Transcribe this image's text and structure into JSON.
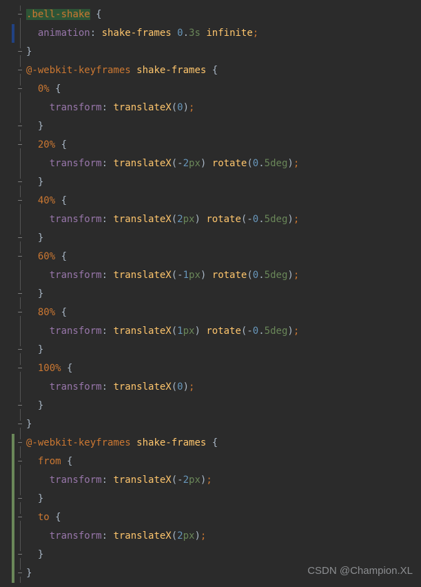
{
  "watermark": "CSDN @Champion.XL",
  "lines": [
    {
      "indent": 0,
      "foldOpen": true,
      "changeBar": "",
      "highlightRange": [
        1,
        12
      ],
      "tokens": [
        ".",
        "bell-shake",
        " ",
        "{"
      ],
      "classes": [
        "c-sel",
        "c-sel",
        "",
        "c-brace"
      ]
    },
    {
      "indent": 1,
      "foldOpen": false,
      "changeBar": "sel",
      "tokens": [
        "animation",
        ": ",
        "shake-frames",
        " ",
        "0",
        ".",
        "3",
        "s",
        " ",
        "infinite",
        ";"
      ],
      "classes": [
        "c-prop",
        "c-punc",
        "c-ident",
        "",
        "c-num",
        "c-punc",
        "c-numg",
        "c-unit",
        "",
        "c-ident",
        "c-semi"
      ]
    },
    {
      "indent": 0,
      "foldClose": true,
      "tokens": [
        "}"
      ],
      "classes": [
        "c-brace"
      ]
    },
    {
      "indent": 0,
      "foldOpen": true,
      "tokens": [
        "@-webkit-keyframes",
        " ",
        "shake-frames",
        " ",
        "{"
      ],
      "classes": [
        "c-sel",
        "",
        "c-ident",
        "",
        "c-brace"
      ]
    },
    {
      "indent": 1,
      "foldOpen": true,
      "tokens": [
        "0%",
        " ",
        "{"
      ],
      "classes": [
        "c-sel",
        "",
        "c-brace"
      ]
    },
    {
      "indent": 2,
      "tokens": [
        "transform",
        ": ",
        "translateX",
        "(",
        "0",
        ")",
        ";"
      ],
      "classes": [
        "c-prop",
        "c-punc",
        "c-func",
        "c-punc",
        "c-num",
        "c-punc",
        "c-semi"
      ]
    },
    {
      "indent": 1,
      "foldClose": true,
      "tokens": [
        "}"
      ],
      "classes": [
        "c-brace"
      ]
    },
    {
      "indent": 1,
      "foldOpen": true,
      "tokens": [
        "20%",
        " ",
        "{"
      ],
      "classes": [
        "c-sel",
        "",
        "c-brace"
      ]
    },
    {
      "indent": 2,
      "tokens": [
        "transform",
        ": ",
        "translateX",
        "(",
        "-",
        "2",
        "px",
        ") ",
        "rotate",
        "(",
        "0",
        ".",
        "5",
        "deg",
        ")",
        ";"
      ],
      "classes": [
        "c-prop",
        "c-punc",
        "c-func",
        "c-punc",
        "c-punc",
        "c-num",
        "c-unit",
        "c-punc",
        "c-func",
        "c-punc",
        "c-num",
        "c-punc",
        "c-numg",
        "c-unit",
        "c-punc",
        "c-semi"
      ]
    },
    {
      "indent": 1,
      "foldClose": true,
      "tokens": [
        "}"
      ],
      "classes": [
        "c-brace"
      ]
    },
    {
      "indent": 1,
      "foldOpen": true,
      "tokens": [
        "40%",
        " ",
        "{"
      ],
      "classes": [
        "c-sel",
        "",
        "c-brace"
      ]
    },
    {
      "indent": 2,
      "tokens": [
        "transform",
        ": ",
        "translateX",
        "(",
        "2",
        "px",
        ") ",
        "rotate",
        "(",
        "-",
        "0",
        ".",
        "5",
        "deg",
        ")",
        ";"
      ],
      "classes": [
        "c-prop",
        "c-punc",
        "c-func",
        "c-punc",
        "c-num",
        "c-unit",
        "c-punc",
        "c-func",
        "c-punc",
        "c-punc",
        "c-num",
        "c-punc",
        "c-numg",
        "c-unit",
        "c-punc",
        "c-semi"
      ]
    },
    {
      "indent": 1,
      "foldClose": true,
      "tokens": [
        "}"
      ],
      "classes": [
        "c-brace"
      ]
    },
    {
      "indent": 1,
      "foldOpen": true,
      "tokens": [
        "60%",
        " ",
        "{"
      ],
      "classes": [
        "c-sel",
        "",
        "c-brace"
      ]
    },
    {
      "indent": 2,
      "tokens": [
        "transform",
        ": ",
        "translateX",
        "(",
        "-",
        "1",
        "px",
        ") ",
        "rotate",
        "(",
        "0",
        ".",
        "5",
        "deg",
        ")",
        ";"
      ],
      "classes": [
        "c-prop",
        "c-punc",
        "c-func",
        "c-punc",
        "c-punc",
        "c-num",
        "c-unit",
        "c-punc",
        "c-func",
        "c-punc",
        "c-num",
        "c-punc",
        "c-numg",
        "c-unit",
        "c-punc",
        "c-semi"
      ]
    },
    {
      "indent": 1,
      "foldClose": true,
      "tokens": [
        "}"
      ],
      "classes": [
        "c-brace"
      ]
    },
    {
      "indent": 1,
      "foldOpen": true,
      "tokens": [
        "80%",
        " ",
        "{"
      ],
      "classes": [
        "c-sel",
        "",
        "c-brace"
      ]
    },
    {
      "indent": 2,
      "tokens": [
        "transform",
        ": ",
        "translateX",
        "(",
        "1",
        "px",
        ") ",
        "rotate",
        "(",
        "-",
        "0",
        ".",
        "5",
        "deg",
        ")",
        ";"
      ],
      "classes": [
        "c-prop",
        "c-punc",
        "c-func",
        "c-punc",
        "c-num",
        "c-unit",
        "c-punc",
        "c-func",
        "c-punc",
        "c-punc",
        "c-num",
        "c-punc",
        "c-numg",
        "c-unit",
        "c-punc",
        "c-semi"
      ]
    },
    {
      "indent": 1,
      "foldClose": true,
      "tokens": [
        "}"
      ],
      "classes": [
        "c-brace"
      ]
    },
    {
      "indent": 1,
      "foldOpen": true,
      "tokens": [
        "100%",
        " ",
        "{"
      ],
      "classes": [
        "c-sel",
        "",
        "c-brace"
      ]
    },
    {
      "indent": 2,
      "tokens": [
        "transform",
        ": ",
        "translateX",
        "(",
        "0",
        ")",
        ";"
      ],
      "classes": [
        "c-prop",
        "c-punc",
        "c-func",
        "c-punc",
        "c-num",
        "c-punc",
        "c-semi"
      ]
    },
    {
      "indent": 1,
      "foldClose": true,
      "tokens": [
        "}"
      ],
      "classes": [
        "c-brace"
      ]
    },
    {
      "indent": 0,
      "foldClose": true,
      "tokens": [
        "}"
      ],
      "classes": [
        "c-brace"
      ]
    },
    {
      "indent": 0,
      "foldOpen": true,
      "changeBar": "mod",
      "tokens": [
        "@-webkit-keyframes",
        " ",
        "shake-frames",
        " ",
        "{"
      ],
      "classes": [
        "c-sel",
        "",
        "c-ident",
        "",
        "c-brace"
      ]
    },
    {
      "indent": 1,
      "foldOpen": true,
      "changeBar": "mod",
      "tokens": [
        "from",
        " ",
        "{"
      ],
      "classes": [
        "c-sel",
        "",
        "c-brace"
      ]
    },
    {
      "indent": 2,
      "changeBar": "mod",
      "tokens": [
        "transform",
        ": ",
        "translateX",
        "(",
        "-",
        "2",
        "px",
        ")",
        ";"
      ],
      "classes": [
        "c-prop",
        "c-punc",
        "c-func",
        "c-punc",
        "c-punc",
        "c-num",
        "c-unit",
        "c-punc",
        "c-semi"
      ]
    },
    {
      "indent": 1,
      "foldClose": true,
      "changeBar": "mod",
      "tokens": [
        "}"
      ],
      "classes": [
        "c-brace"
      ]
    },
    {
      "indent": 1,
      "foldOpen": true,
      "changeBar": "mod",
      "tokens": [
        "to",
        " ",
        "{"
      ],
      "classes": [
        "c-sel",
        "",
        "c-brace"
      ]
    },
    {
      "indent": 2,
      "changeBar": "mod",
      "tokens": [
        "transform",
        ": ",
        "translateX",
        "(",
        "2",
        "px",
        ")",
        ";"
      ],
      "classes": [
        "c-prop",
        "c-punc",
        "c-func",
        "c-punc",
        "c-num",
        "c-unit",
        "c-punc",
        "c-semi"
      ]
    },
    {
      "indent": 1,
      "foldClose": true,
      "changeBar": "mod",
      "tokens": [
        "}"
      ],
      "classes": [
        "c-brace"
      ]
    },
    {
      "indent": 0,
      "foldClose": true,
      "changeBar": "mod",
      "tokens": [
        "}"
      ],
      "classes": [
        "c-brace"
      ]
    }
  ]
}
